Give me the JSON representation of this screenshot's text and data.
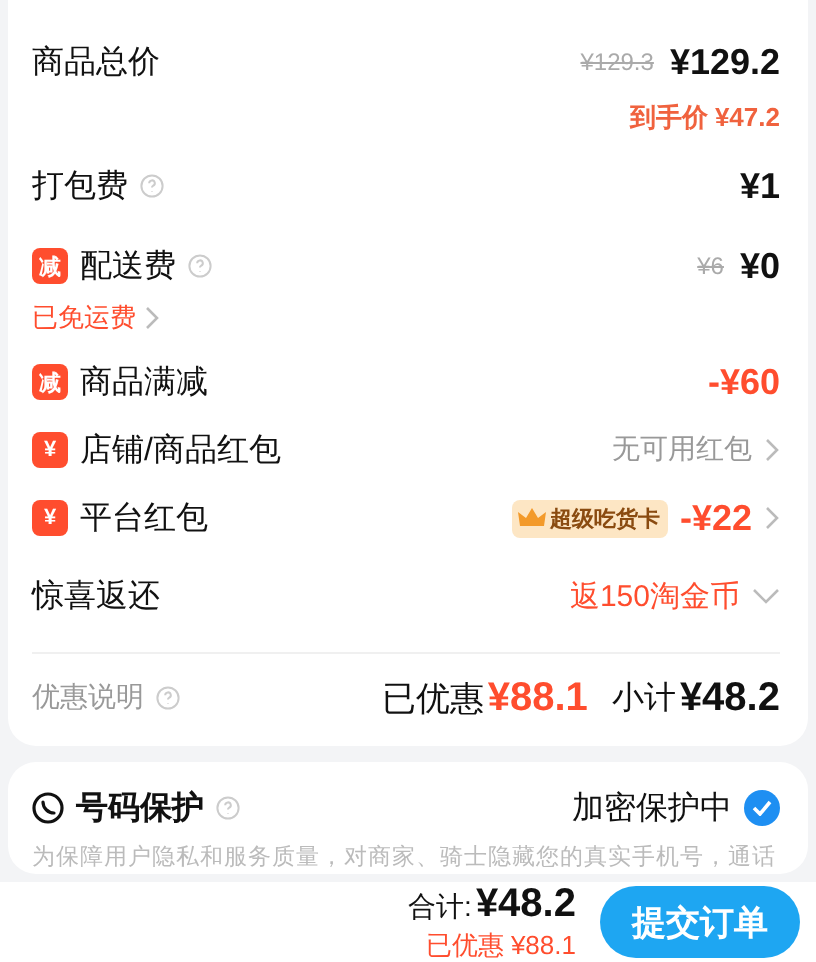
{
  "summary": {
    "rows": [
      {
        "kind": "total",
        "label": "商品总价",
        "original_price": "¥129.3",
        "price": "¥129.2",
        "note": "到手价 ¥47.2"
      },
      {
        "kind": "fee",
        "label": "打包费",
        "help": true,
        "price": "¥1"
      },
      {
        "kind": "fee",
        "label": "配送费",
        "badge": "减",
        "help": true,
        "original_price": "¥6",
        "price": "¥0",
        "link": "已免运费"
      },
      {
        "kind": "discount",
        "label": "商品满减",
        "badge": "减",
        "price": "-¥60"
      },
      {
        "kind": "coupon",
        "label": "店铺/商品红包",
        "badge": "¥",
        "status": "无可用红包"
      },
      {
        "kind": "coupon",
        "label": "平台红包",
        "badge": "¥",
        "tag": "超级吃货卡",
        "price": "-¥22"
      },
      {
        "kind": "reward",
        "label": "惊喜返还",
        "value": "返150淘金币"
      }
    ],
    "footer": {
      "label": "优惠说明",
      "saved_label": "已优惠",
      "saved": "¥88.1",
      "subtotal_label": "小计",
      "subtotal": "¥48.2"
    }
  },
  "privacy": {
    "title": "号码保护",
    "status": "加密保护中",
    "checked": true,
    "description": "为保障用户隐私和服务质量，对商家、骑士隐藏您的真实手机号，通话"
  },
  "bottom_bar": {
    "total_label": "合计:",
    "total": "¥48.2",
    "saved": "已优惠 ¥88.1",
    "button": "提交订单"
  }
}
